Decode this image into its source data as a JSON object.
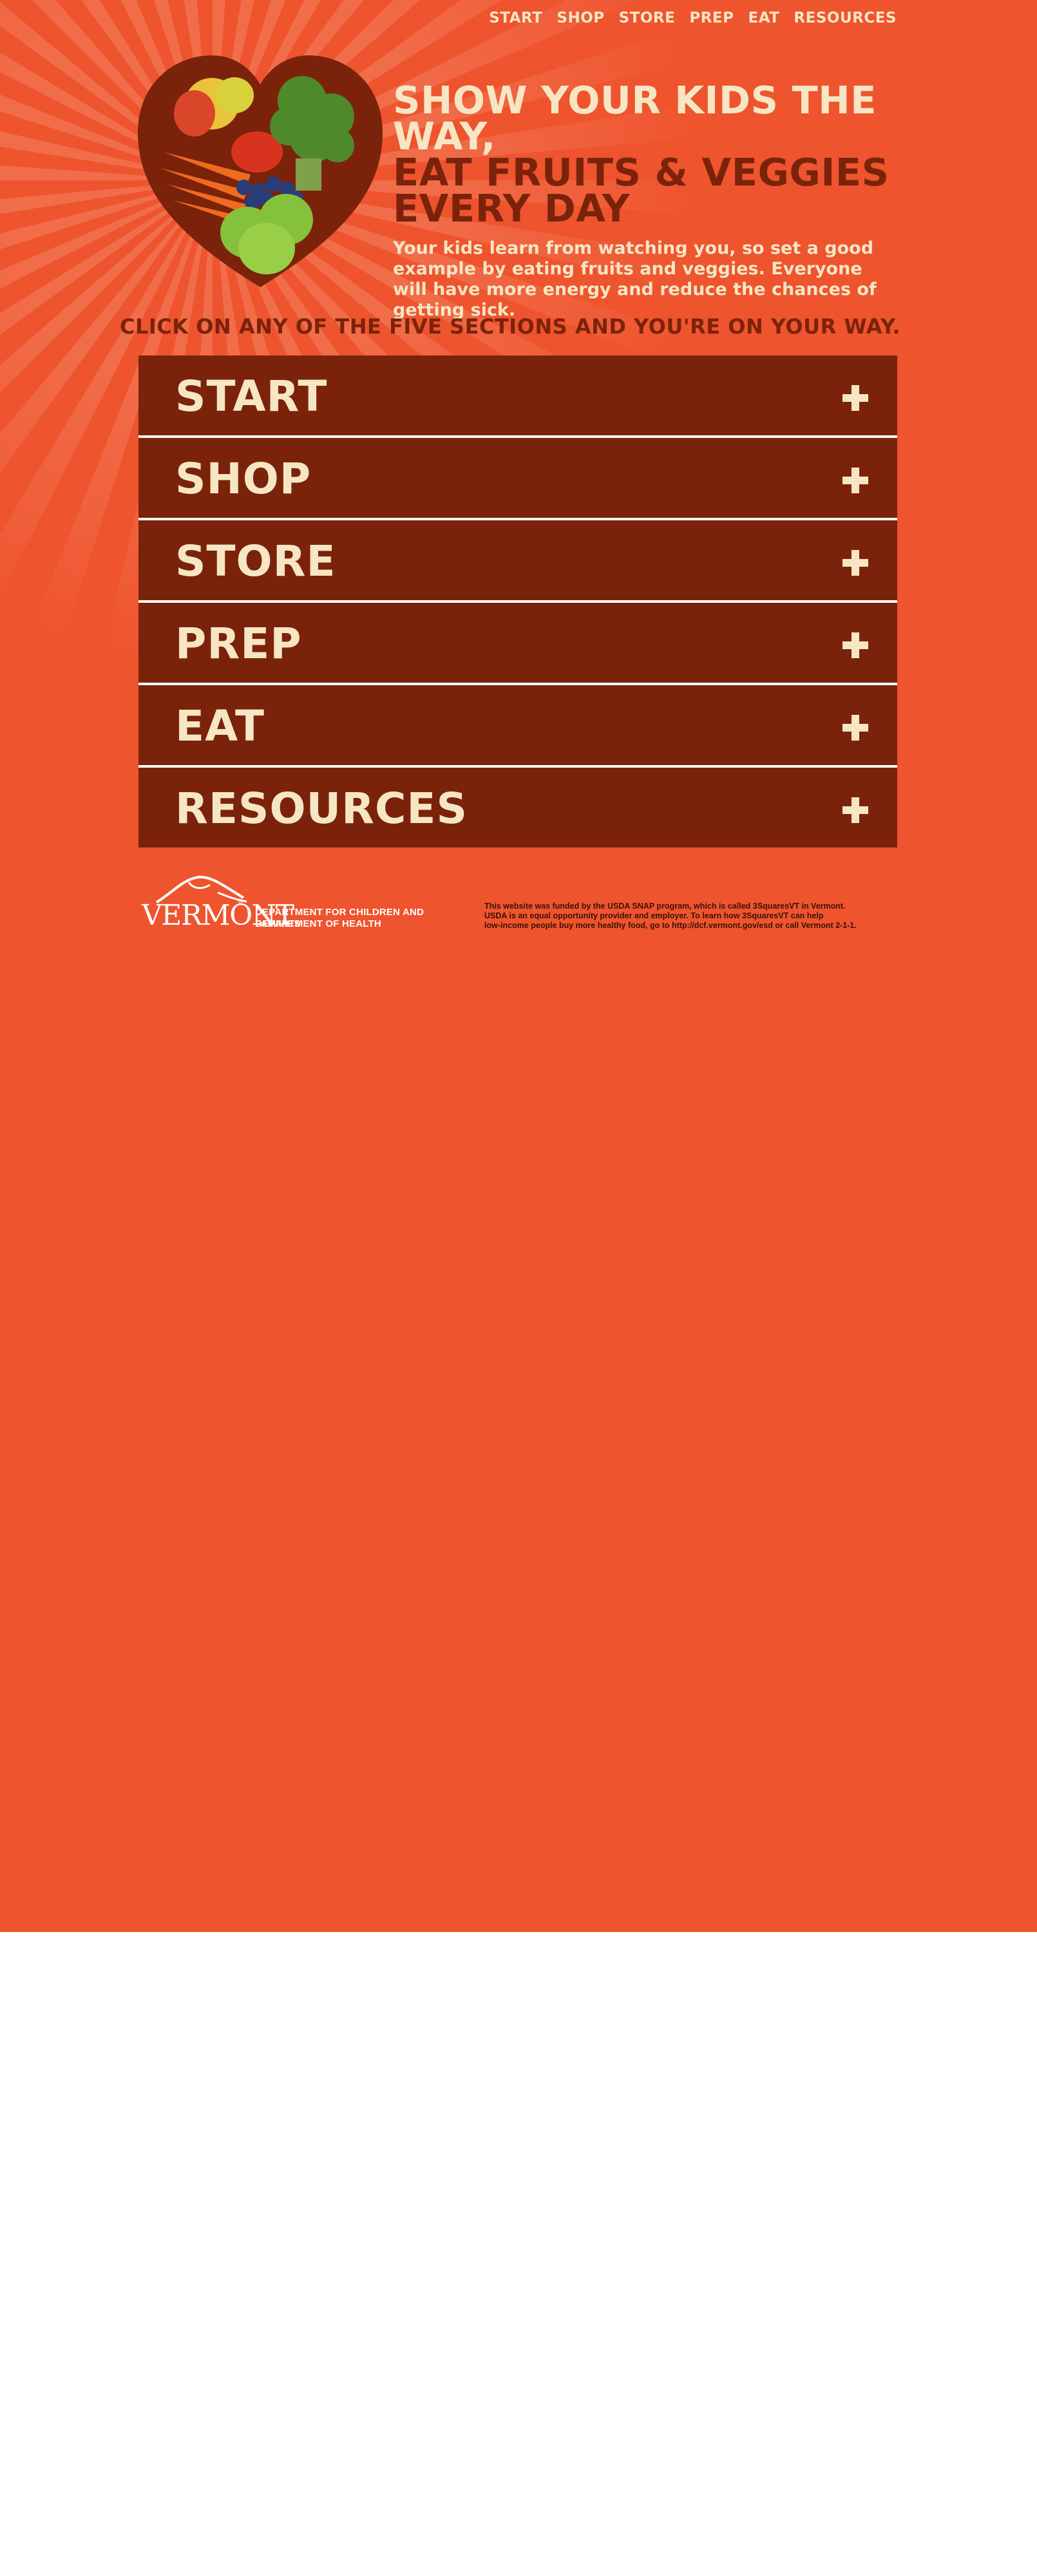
{
  "nav": {
    "items": [
      {
        "label": "START"
      },
      {
        "label": "SHOP"
      },
      {
        "label": "STORE"
      },
      {
        "label": "PREP"
      },
      {
        "label": "EAT"
      },
      {
        "label": "RESOURCES"
      }
    ]
  },
  "hero": {
    "headline_line1": "SHOW YOUR KIDS THE WAY,",
    "headline_line2": "EAT FRUITS & VEGGIES",
    "headline_line3": "EVERY DAY",
    "body": "Your kids learn from watching you, so set a good example by eating fruits and veggies. Everyone will have more energy and reduce the chances of getting sick."
  },
  "instruction": "CLICK ON ANY OF THE FIVE SECTIONS AND YOU'RE ON YOUR WAY.",
  "sections": [
    {
      "label": "START"
    },
    {
      "label": "SHOP"
    },
    {
      "label": "STORE"
    },
    {
      "label": "PREP"
    },
    {
      "label": "EAT"
    },
    {
      "label": "RESOURCES"
    }
  ],
  "footer": {
    "logo_text": "VERMONT",
    "dept1": "DEPARTMENT FOR CHILDREN AND FAMILIES",
    "dept2": "DEPARTMENT OF HEALTH",
    "legal_line1": "This website was funded by the USDA SNAP program, which is called 3SquaresVT in Vermont.",
    "legal_line2": "USDA is an equal opportunity provider and employer. To learn how 3SquaresVT can help",
    "legal_line3": "low-income people buy more healthy food, go to http://dcf.vermont.gov/esd or call Vermont 2-1-1."
  },
  "colors": {
    "background": "#ee542e",
    "dark_brown": "#7a230a",
    "cream": "#f6e6c4"
  }
}
